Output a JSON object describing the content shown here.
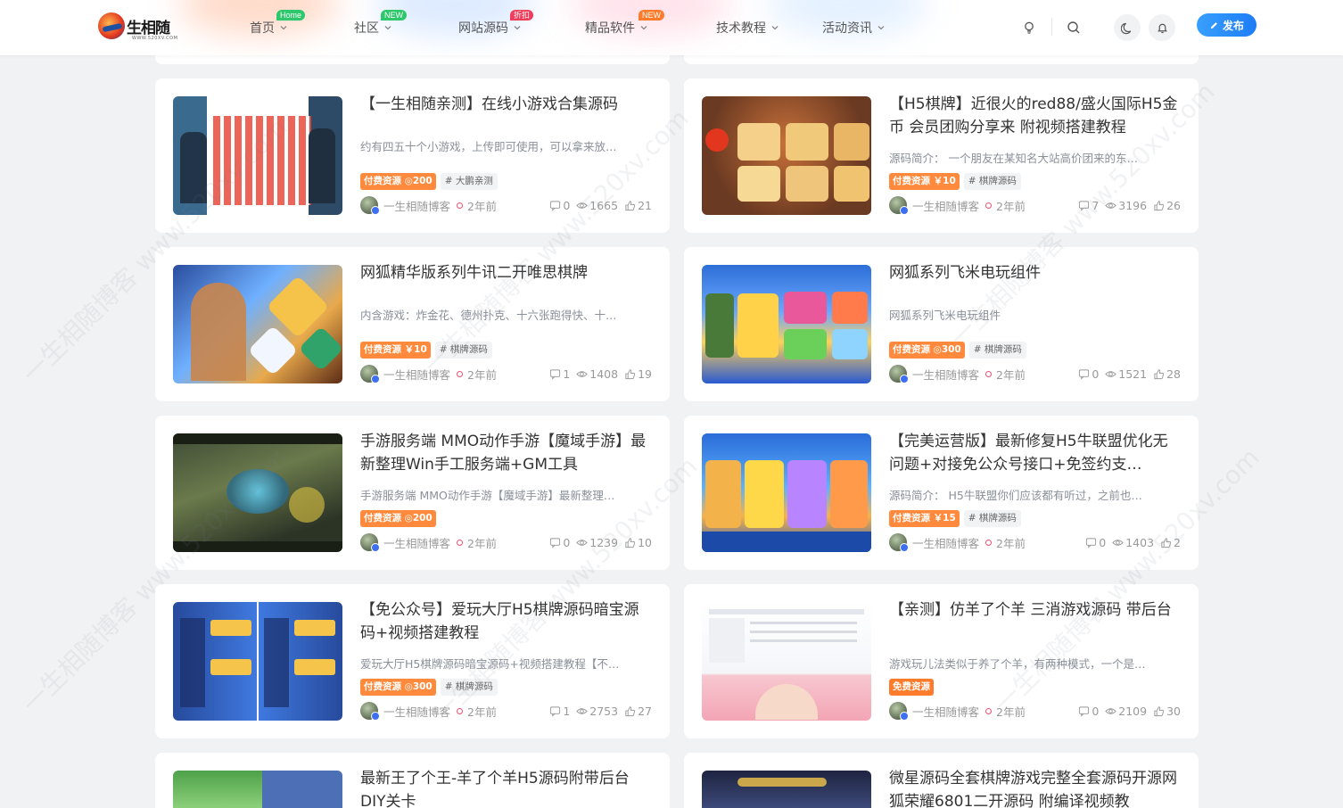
{
  "brand": {
    "logo_text": "生相随",
    "logo_sub": "WWW.520XV.COM"
  },
  "nav": [
    {
      "label": "首页",
      "badge": "Home",
      "badge_color": "#2ec76c"
    },
    {
      "label": "社区",
      "badge": "NEW",
      "badge_color": "#2ec76c"
    },
    {
      "label": "网站源码",
      "badge": "折扣",
      "badge_color": "#ef3e5c"
    },
    {
      "label": "精品软件",
      "badge": "NEW",
      "badge_color": "#ff7b2c"
    },
    {
      "label": "技术教程",
      "badge": ""
    },
    {
      "label": "活动资讯",
      "badge": ""
    }
  ],
  "header_actions": {
    "publish": "发布"
  },
  "cards": [
    {
      "title": "【一生相随亲测】在线小游戏合集源码",
      "desc": "约有四五十个小游戏，上传即可使用，可以拿来放…",
      "price_tag": "付费资源 ◎200",
      "category": "# 大鹏亲测",
      "author": "一生相随博客",
      "time": "2年前",
      "comments": "0",
      "views": "1665",
      "likes": "21"
    },
    {
      "title": "【H5棋牌】近很火的red88/盛火国际H5金币 会员团购分享来 附视频搭建教程",
      "desc": "源码简介： 一个朋友在某知名大站高价团来的东…",
      "price_tag": "付费资源 ￥10",
      "category": "# 棋牌源码",
      "author": "一生相随博客",
      "time": "2年前",
      "comments": "7",
      "views": "3196",
      "likes": "26"
    },
    {
      "title": "网狐精华版系列牛讯二开唯思棋牌",
      "desc": "内含游戏：炸金花、德州扑克、十六张跑得快、十…",
      "price_tag": "付费资源 ￥10",
      "category": "# 棋牌源码",
      "author": "一生相随博客",
      "time": "2年前",
      "comments": "1",
      "views": "1408",
      "likes": "19"
    },
    {
      "title": "网狐系列飞米电玩组件",
      "desc": "网狐系列飞米电玩组件",
      "price_tag": "付费资源 ◎300",
      "category": "# 棋牌源码",
      "author": "一生相随博客",
      "time": "2年前",
      "comments": "0",
      "views": "1521",
      "likes": "28"
    },
    {
      "title": "手游服务端 MMO动作手游【魔域手游】最新整理Win手工服务端+GM工具",
      "desc": "手游服务端 MMO动作手游【魔域手游】最新整理…",
      "price_tag": "付费资源 ◎200",
      "category": "",
      "author": "一生相随博客",
      "time": "2年前",
      "comments": "0",
      "views": "1239",
      "likes": "10"
    },
    {
      "title": "【完美运营版】最新修复H5牛联盟优化无问题+对接免公众号接口+免签约支…",
      "desc": "源码简介： H5牛联盟你们应该都有听过，之前也…",
      "price_tag": "付费资源 ￥15",
      "category": "# 棋牌源码",
      "author": "一生相随博客",
      "time": "2年前",
      "comments": "0",
      "views": "1403",
      "likes": "2"
    },
    {
      "title": "【免公众号】爱玩大厅H5棋牌源码暗宝源码+视频搭建教程",
      "desc": "爱玩大厅H5棋牌源码暗宝源码+视频搭建教程【不…",
      "price_tag": "付费资源 ◎300",
      "category": "# 棋牌源码",
      "author": "一生相随博客",
      "time": "2年前",
      "comments": "1",
      "views": "2753",
      "likes": "27"
    },
    {
      "title": "【亲测】仿羊了个羊 三消游戏源码 带后台",
      "desc": "游戏玩儿法类似于养了个羊，有两种模式，一个是…",
      "price_tag": "免费资源",
      "category": "",
      "author": "一生相随博客",
      "time": "2年前",
      "comments": "0",
      "views": "2109",
      "likes": "30"
    },
    {
      "title": "最新王了个王-羊了个羊H5源码附带后台DIY关卡",
      "desc": "",
      "price_tag": "",
      "category": "",
      "author": "",
      "time": "",
      "comments": "",
      "views": "",
      "likes": ""
    },
    {
      "title": "微星源码全套棋牌游戏完整全套源码开源网狐荣耀6801二开源码 附编译视频教",
      "desc": "",
      "price_tag": "",
      "category": "",
      "author": "",
      "time": "",
      "comments": "",
      "views": "",
      "likes": ""
    }
  ],
  "watermarks": [
    "一生相随博客 www.520xv.com"
  ]
}
